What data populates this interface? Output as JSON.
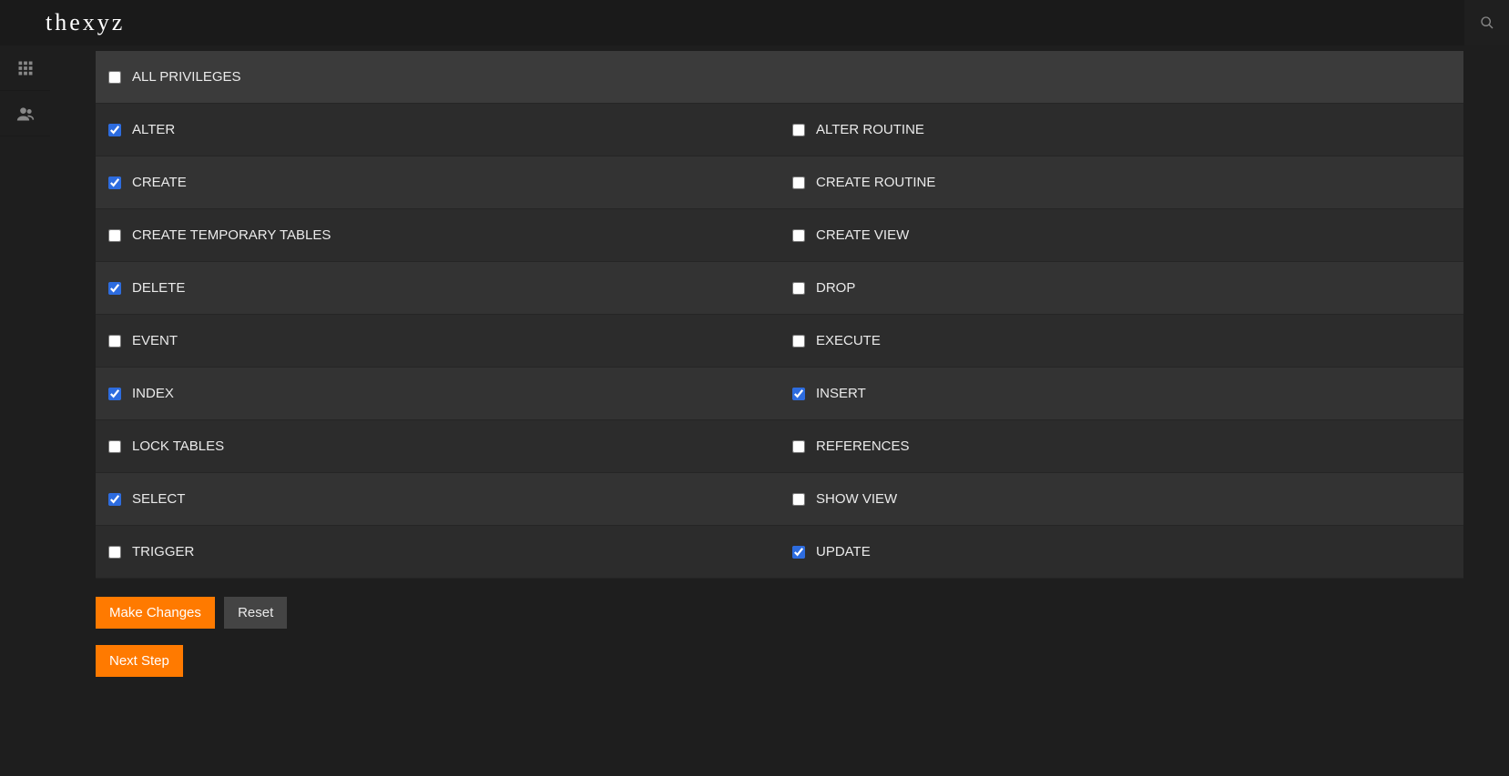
{
  "brand": "thexyz",
  "privileges": {
    "all": {
      "label": "ALL PRIVILEGES",
      "checked": false
    },
    "rows": [
      {
        "left": {
          "label": "ALTER",
          "checked": true
        },
        "right": {
          "label": "ALTER ROUTINE",
          "checked": false
        }
      },
      {
        "left": {
          "label": "CREATE",
          "checked": true
        },
        "right": {
          "label": "CREATE ROUTINE",
          "checked": false
        }
      },
      {
        "left": {
          "label": "CREATE TEMPORARY TABLES",
          "checked": false
        },
        "right": {
          "label": "CREATE VIEW",
          "checked": false
        }
      },
      {
        "left": {
          "label": "DELETE",
          "checked": true
        },
        "right": {
          "label": "DROP",
          "checked": false
        }
      },
      {
        "left": {
          "label": "EVENT",
          "checked": false
        },
        "right": {
          "label": "EXECUTE",
          "checked": false
        }
      },
      {
        "left": {
          "label": "INDEX",
          "checked": true
        },
        "right": {
          "label": "INSERT",
          "checked": true
        }
      },
      {
        "left": {
          "label": "LOCK TABLES",
          "checked": false
        },
        "right": {
          "label": "REFERENCES",
          "checked": false
        }
      },
      {
        "left": {
          "label": "SELECT",
          "checked": true
        },
        "right": {
          "label": "SHOW VIEW",
          "checked": false
        }
      },
      {
        "left": {
          "label": "TRIGGER",
          "checked": false
        },
        "right": {
          "label": "UPDATE",
          "checked": true
        }
      }
    ]
  },
  "buttons": {
    "make_changes": "Make Changes",
    "reset": "Reset",
    "next_step": "Next Step"
  }
}
